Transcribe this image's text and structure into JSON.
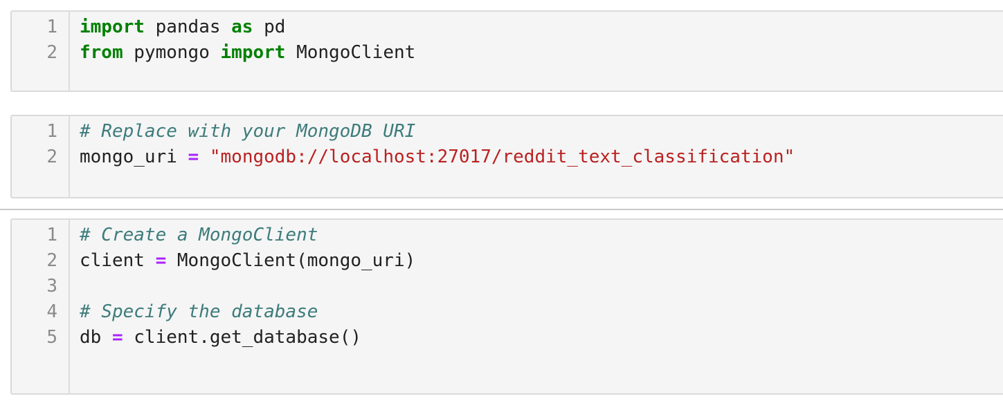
{
  "cells": [
    {
      "lines": [
        {
          "n": "1",
          "tokens": [
            {
              "t": "import",
              "k": "kw"
            },
            {
              "t": " pandas ",
              "k": "plain"
            },
            {
              "t": "as",
              "k": "kw"
            },
            {
              "t": " pd",
              "k": "plain"
            }
          ]
        },
        {
          "n": "2",
          "tokens": [
            {
              "t": "from",
              "k": "kw"
            },
            {
              "t": " pymongo ",
              "k": "plain"
            },
            {
              "t": "import",
              "k": "kw"
            },
            {
              "t": " MongoClient",
              "k": "plain"
            }
          ]
        }
      ]
    },
    {
      "lines": [
        {
          "n": "1",
          "tokens": [
            {
              "t": "# Replace with your MongoDB URI",
              "k": "cm"
            }
          ]
        },
        {
          "n": "2",
          "tokens": [
            {
              "t": "mongo_uri ",
              "k": "plain"
            },
            {
              "t": "=",
              "k": "op"
            },
            {
              "t": " ",
              "k": "plain"
            },
            {
              "t": "\"mongodb://localhost:27017/reddit_text_classification\"",
              "k": "str"
            }
          ]
        }
      ]
    },
    {
      "lines": [
        {
          "n": "1",
          "tokens": [
            {
              "t": "# Create a MongoClient",
              "k": "cm"
            }
          ]
        },
        {
          "n": "2",
          "tokens": [
            {
              "t": "client ",
              "k": "plain"
            },
            {
              "t": "=",
              "k": "op"
            },
            {
              "t": " MongoClient(mongo_uri)",
              "k": "plain"
            }
          ]
        },
        {
          "n": "3",
          "tokens": []
        },
        {
          "n": "4",
          "tokens": [
            {
              "t": "# Specify the database",
              "k": "cm"
            }
          ]
        },
        {
          "n": "5",
          "tokens": [
            {
              "t": "db ",
              "k": "plain"
            },
            {
              "t": "=",
              "k": "op"
            },
            {
              "t": " client.get_database()",
              "k": "plain"
            }
          ]
        }
      ]
    }
  ]
}
